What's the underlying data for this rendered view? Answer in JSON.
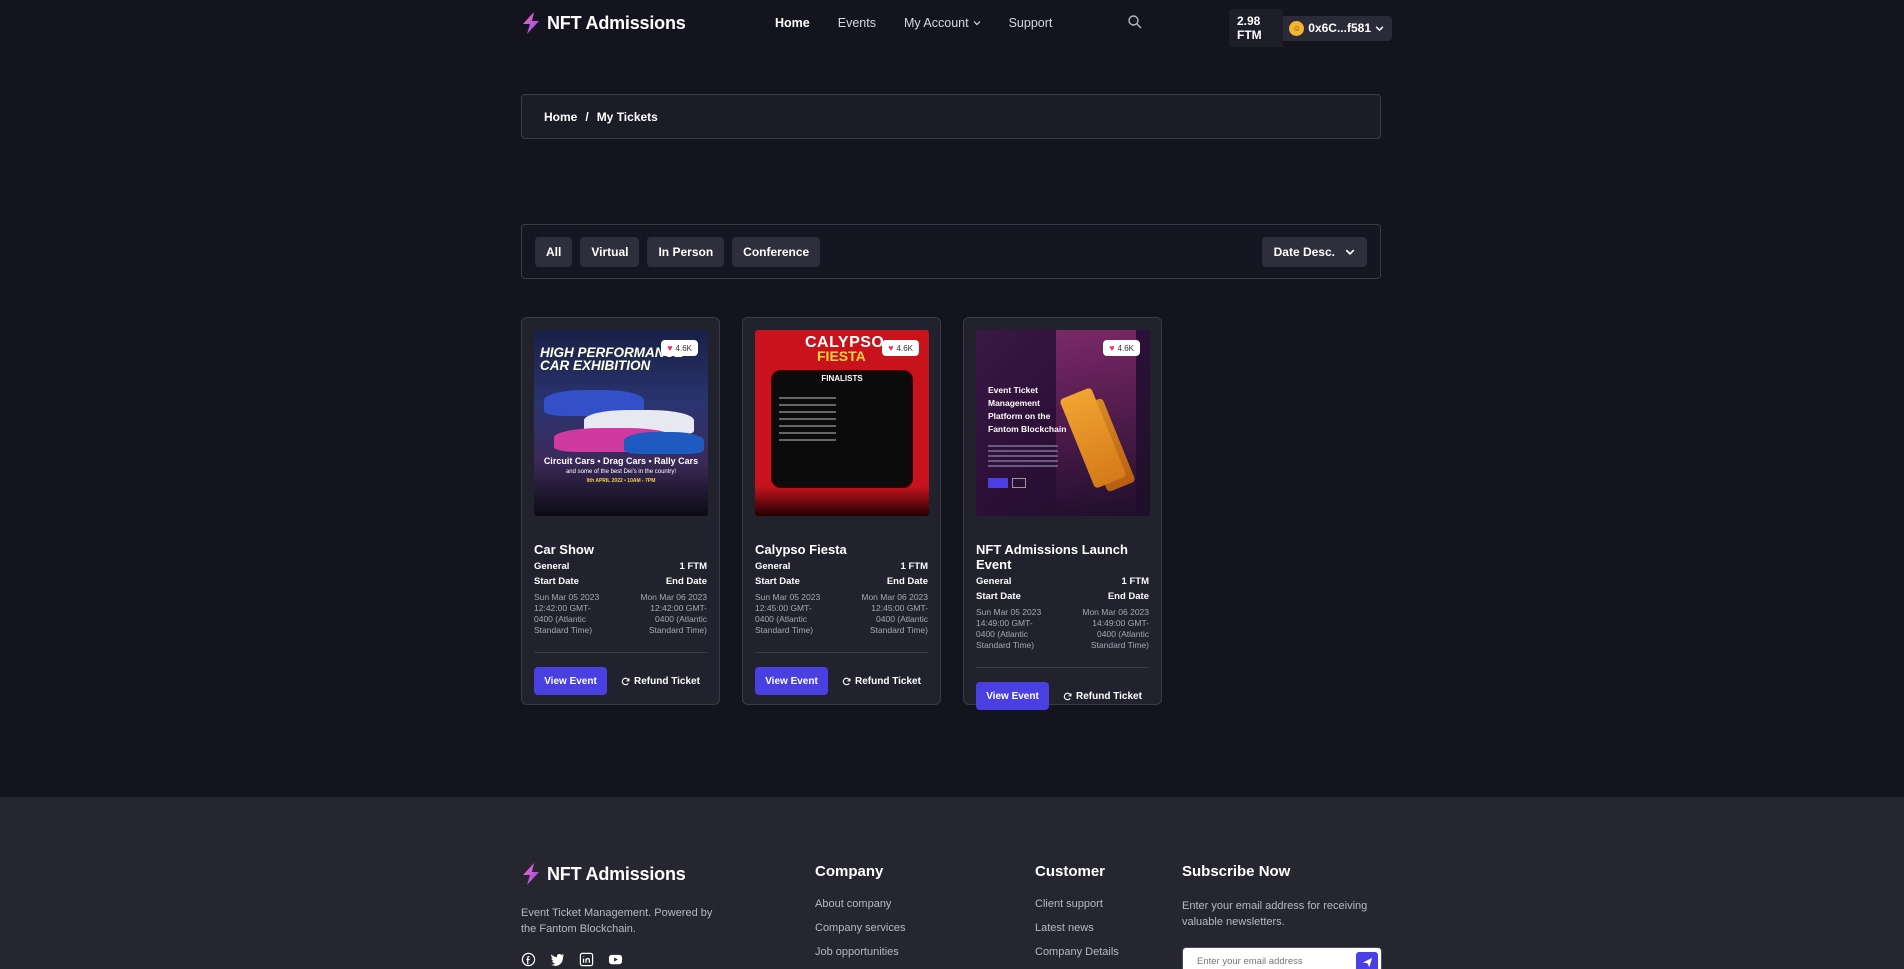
{
  "brand": {
    "name": "NFT Admissions"
  },
  "nav": {
    "home": "Home",
    "events": "Events",
    "account": "My Account",
    "support": "Support"
  },
  "wallet": {
    "balance": "2.98 FTM",
    "address": "0x6C...f581"
  },
  "breadcrumb": {
    "home": "Home",
    "separator": "/",
    "current": "My Tickets"
  },
  "filters": {
    "all": "All",
    "virtual": "Virtual",
    "in_person": "In Person",
    "conference": "Conference",
    "sort": "Date Desc."
  },
  "cards": [
    {
      "likes": "4.6K",
      "title": "Car Show",
      "type": "General",
      "price": "1 FTM",
      "start_label": "Start Date",
      "end_label": "End Date",
      "start": "Sun Mar 05 2023 12:42:00 GMT-0400 (Atlantic Standard Time)",
      "end": "Mon Mar 06 2023 12:42:00 GMT-0400 (Atlantic Standard Time)",
      "view": "View Event",
      "refund": "Refund Ticket",
      "img_title": "HIGH PERFORMANCE CAR EXHIBITION",
      "img_sub": "Circuit Cars • Drag Cars • Rally Cars",
      "img_sub2": "and some of the best Dei's in the country!",
      "img_date": "9th APRIL 2022 • 10AM - 7PM"
    },
    {
      "likes": "4.6K",
      "title": "Calypso Fiesta",
      "type": "General",
      "price": "1 FTM",
      "start_label": "Start Date",
      "end_label": "End Date",
      "start": "Sun Mar 05 2023 12:45:00 GMT-0400 (Atlantic Standard Time)",
      "end": "Mon Mar 06 2023 12:45:00 GMT-0400 (Atlantic Standard Time)",
      "view": "View Event",
      "refund": "Refund Ticket",
      "img_title": "CALYPSO",
      "img_title2": "FIESTA",
      "img_board": "FINALISTS"
    },
    {
      "likes": "4.6K",
      "title": "NFT Admissions Launch Event",
      "type": "General",
      "price": "1 FTM",
      "start_label": "Start Date",
      "end_label": "End Date",
      "start": "Sun Mar 05 2023 14:49:00 GMT-0400 (Atlantic Standard Time)",
      "end": "Mon Mar 06 2023 14:49:00 GMT-0400 (Atlantic Standard Time)",
      "view": "View Event",
      "refund": "Refund Ticket",
      "img_title": "Event Ticket Management Platform on the Fantom Blockchain"
    }
  ],
  "footer": {
    "brand": "NFT Admissions",
    "desc": "Event Ticket Management. Powered by the Fantom Blockchain.",
    "company": {
      "title": "Company",
      "links": [
        "About company",
        "Company services",
        "Job opportunities"
      ]
    },
    "customer": {
      "title": "Customer",
      "links": [
        "Client support",
        "Latest news",
        "Company Details"
      ]
    },
    "subscribe": {
      "title": "Subscribe Now",
      "text": "Enter your email address for receiving valuable newsletters.",
      "placeholder": "Enter your email address"
    }
  }
}
